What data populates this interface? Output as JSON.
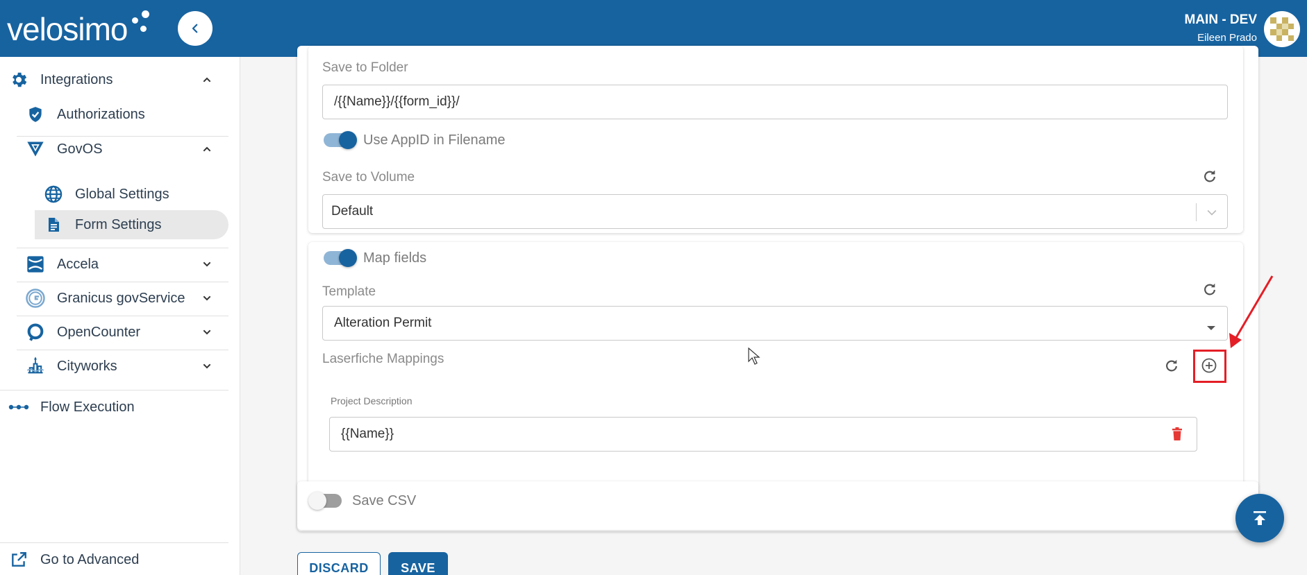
{
  "header": {
    "logo_text": "velosimo",
    "env_title": "MAIN - DEV",
    "user_name": "Eileen Prado"
  },
  "sidebar": {
    "integrations": "Integrations",
    "authorizations": "Authorizations",
    "govos": "GovOS",
    "global_settings": "Global Settings",
    "form_settings": "Form Settings",
    "accela": "Accela",
    "granicus": "Granicus govService",
    "opencounter": "OpenCounter",
    "cityworks": "Cityworks",
    "flow_execution": "Flow Execution",
    "go_advanced": "Go to Advanced"
  },
  "form": {
    "save_to_folder_label": "Save to Folder",
    "save_to_folder_value": "/{{Name}}/{{form_id}}/",
    "use_appid_label": "Use AppID in Filename",
    "save_to_volume_label": "Save to Volume",
    "save_to_volume_value": "Default",
    "map_fields_label": "Map fields",
    "template_label": "Template",
    "template_value": "Alteration Permit",
    "laserfiche_label": "Laserfiche Mappings",
    "project_description_label": "Project Description",
    "project_description_value": "{{Name}}",
    "save_csv_label": "Save CSV"
  },
  "actions": {
    "discard": "DISCARD",
    "save": "SAVE"
  },
  "colors": {
    "brand": "#1763a0",
    "annotation": "#e41e26",
    "delete": "#e53935"
  }
}
